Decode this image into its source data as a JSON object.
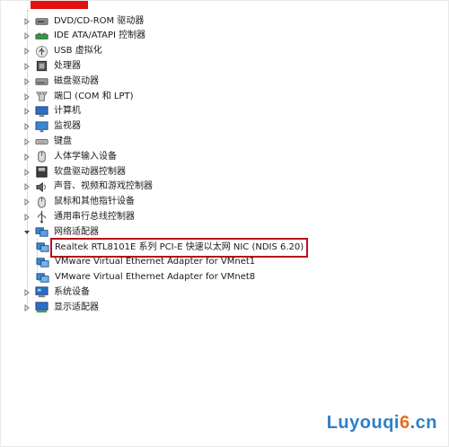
{
  "header": {
    "title": ""
  },
  "tree": [
    {
      "id": "dvd",
      "label": "DVD/CD-ROM 驱动器",
      "icon": "dvd-drive-icon",
      "level": 1,
      "expanded": false
    },
    {
      "id": "ide",
      "label": "IDE ATA/ATAPI 控制器",
      "icon": "ide-controller-icon",
      "level": 1,
      "expanded": false
    },
    {
      "id": "usb",
      "label": "USB 虚拟化",
      "icon": "usb-icon",
      "level": 1,
      "expanded": false
    },
    {
      "id": "cpu",
      "label": "处理器",
      "icon": "processor-icon",
      "level": 1,
      "expanded": false
    },
    {
      "id": "disk",
      "label": "磁盘驱动器",
      "icon": "disk-drive-icon",
      "level": 1,
      "expanded": false
    },
    {
      "id": "ports",
      "label": "端口 (COM 和 LPT)",
      "icon": "port-icon",
      "level": 1,
      "expanded": false
    },
    {
      "id": "computer",
      "label": "计算机",
      "icon": "computer-icon",
      "level": 1,
      "expanded": false
    },
    {
      "id": "monitor",
      "label": "监视器",
      "icon": "monitor-icon",
      "level": 1,
      "expanded": false
    },
    {
      "id": "keyboard",
      "label": "键盘",
      "icon": "keyboard-icon",
      "level": 1,
      "expanded": false
    },
    {
      "id": "hid",
      "label": "人体学输入设备",
      "icon": "hid-icon",
      "level": 1,
      "expanded": false
    },
    {
      "id": "floppy",
      "label": "软盘驱动器控制器",
      "icon": "floppy-controller-icon",
      "level": 1,
      "expanded": false
    },
    {
      "id": "sound",
      "label": "声音、视频和游戏控制器",
      "icon": "sound-icon",
      "level": 1,
      "expanded": false
    },
    {
      "id": "mouse",
      "label": "鼠标和其他指针设备",
      "icon": "mouse-icon",
      "level": 1,
      "expanded": false
    },
    {
      "id": "serialbus",
      "label": "通用串行总线控制器",
      "icon": "usb-controller-icon",
      "level": 1,
      "expanded": false
    },
    {
      "id": "network",
      "label": "网络适配器",
      "icon": "network-adapter-icon",
      "level": 1,
      "expanded": true
    },
    {
      "id": "realtek",
      "label": "Realtek RTL8101E 系列 PCI-E 快速以太网 NIC (NDIS 6.20)",
      "icon": "network-card-icon",
      "level": 2,
      "selected": true
    },
    {
      "id": "vmnet1",
      "label": "VMware Virtual Ethernet Adapter for VMnet1",
      "icon": "network-card-icon",
      "level": 2
    },
    {
      "id": "vmnet8",
      "label": "VMware Virtual Ethernet Adapter for VMnet8",
      "icon": "network-card-icon",
      "level": 2
    },
    {
      "id": "system",
      "label": "系统设备",
      "icon": "system-device-icon",
      "level": 1,
      "expanded": false
    },
    {
      "id": "display",
      "label": "显示适配器",
      "icon": "display-adapter-icon",
      "level": 1,
      "expanded": false
    }
  ],
  "watermark": {
    "part1": "Luyouqi",
    "part2": "6",
    "part3": ".cn"
  },
  "colors": {
    "selection_border": "#b5121b",
    "top_bar": "#e4100f",
    "watermark_blue": "#2d7fc8",
    "watermark_orange": "#e86e1c"
  }
}
